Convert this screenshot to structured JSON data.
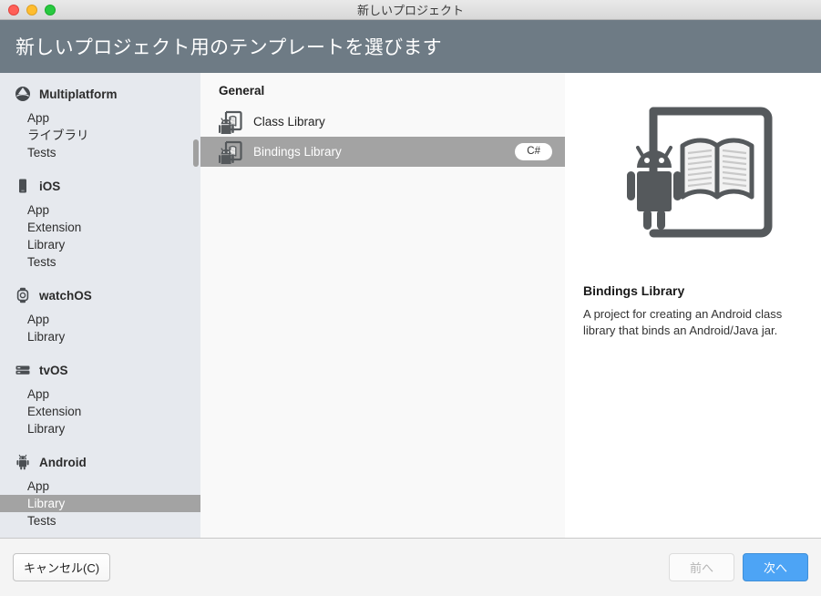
{
  "window": {
    "title": "新しいプロジェクト",
    "traffic_lights": [
      "close-button",
      "minimize-button",
      "maximize-button"
    ]
  },
  "header": {
    "title": "新しいプロジェクト用のテンプレートを選びます",
    "background": "#6e7b85"
  },
  "sidebar": {
    "groups": [
      {
        "label": "Multiplatform",
        "icon": "multiplatform-icon",
        "items": [
          {
            "label": "App",
            "selected": false
          },
          {
            "label": "ライブラリ",
            "selected": false
          },
          {
            "label": "Tests",
            "selected": false
          }
        ]
      },
      {
        "label": "iOS",
        "icon": "iphone-icon",
        "items": [
          {
            "label": "App",
            "selected": false
          },
          {
            "label": "Extension",
            "selected": false
          },
          {
            "label": "Library",
            "selected": false
          },
          {
            "label": "Tests",
            "selected": false
          }
        ]
      },
      {
        "label": "watchOS",
        "icon": "watch-icon",
        "items": [
          {
            "label": "App",
            "selected": false
          },
          {
            "label": "Library",
            "selected": false
          }
        ]
      },
      {
        "label": "tvOS",
        "icon": "tv-icon",
        "items": [
          {
            "label": "App",
            "selected": false
          },
          {
            "label": "Extension",
            "selected": false
          },
          {
            "label": "Library",
            "selected": false
          }
        ]
      },
      {
        "label": "Android",
        "icon": "android-icon",
        "items": [
          {
            "label": "App",
            "selected": false
          },
          {
            "label": "Library",
            "selected": true
          },
          {
            "label": "Tests",
            "selected": false
          }
        ]
      }
    ],
    "selection_color": "#a3a3a3",
    "background": "#e6e9ee"
  },
  "templates": {
    "category": "General",
    "items": [
      {
        "name": "Class Library",
        "icon": "android-library-icon",
        "badge": "",
        "selected": false
      },
      {
        "name": "Bindings Library",
        "icon": "android-library-icon",
        "badge": "C#",
        "selected": true
      }
    ]
  },
  "preview": {
    "icon": "android-bindings-library-art",
    "title": "Bindings Library",
    "description": "A project for creating an Android class library that binds an Android/Java jar."
  },
  "footer": {
    "cancel_label": "キャンセル(C)",
    "back_label": "前へ",
    "next_label": "次へ",
    "next_color": "#4da4f5",
    "back_disabled": true
  }
}
